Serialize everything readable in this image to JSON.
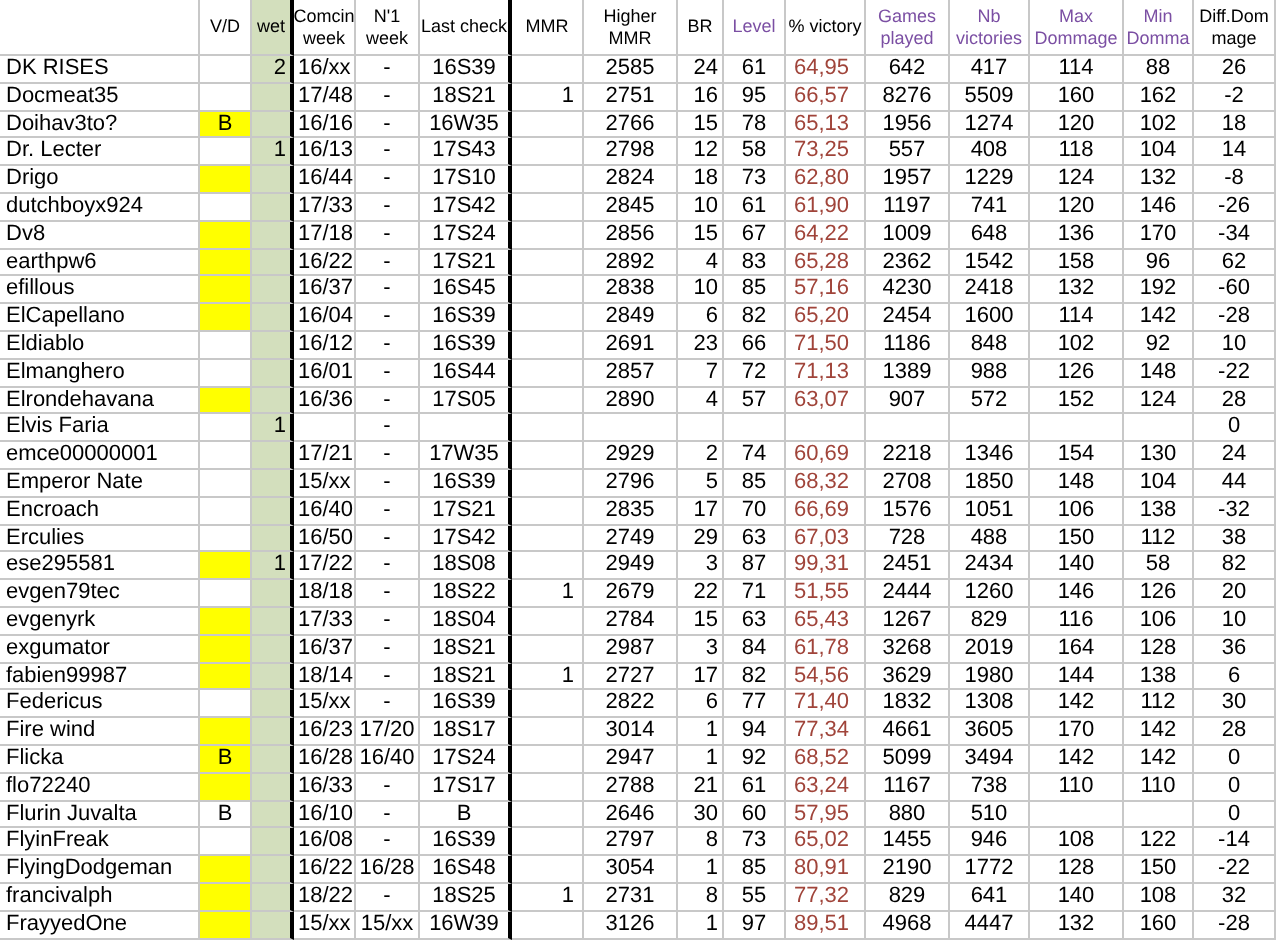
{
  "table": {
    "columns": [
      {},
      {
        "label": "V/D"
      },
      {
        "label": "wet"
      },
      {
        "label": "Comcin\nweek"
      },
      {
        "label": "N'1\nweek"
      },
      {
        "label": "Last check"
      },
      {
        "label": "MMR"
      },
      {
        "label": "Higher\nMMR"
      },
      {
        "label": "BR"
      },
      {
        "label": "Level",
        "color": "#7b4fa3"
      },
      {
        "label": "% victory"
      },
      {
        "label": "Games\nplayed",
        "color": "#7b4fa3"
      },
      {
        "label": "Nb\nvictories",
        "color": "#7b4fa3"
      },
      {
        "label": "Max\nDommage",
        "color": "#7b4fa3"
      },
      {
        "label": "Min\nDomma",
        "color": "#7b4fa3"
      },
      {
        "label": "Diff.Dom\nmage"
      }
    ],
    "rows": [
      {
        "highlighted": false,
        "cells": [
          "DK RISES",
          null,
          "2",
          "16/xx",
          "-",
          "16S39",
          null,
          "2585",
          "24",
          "61",
          "64,95",
          "642",
          "417",
          "114",
          "88",
          "26"
        ]
      },
      {
        "highlighted": false,
        "cells": [
          "Docmeat35",
          null,
          null,
          "17/48",
          "-",
          "18S21",
          "1",
          "2751",
          "16",
          "95",
          "66,57",
          "8276",
          "5509",
          "160",
          "162",
          "-2"
        ]
      },
      {
        "highlighted": true,
        "cells": [
          "Doihav3to?",
          "B",
          null,
          "16/16",
          "-",
          "16W35",
          null,
          "2766",
          "15",
          "78",
          "65,13",
          "1956",
          "1274",
          "120",
          "102",
          "18"
        ]
      },
      {
        "highlighted": false,
        "cells": [
          "Dr. Lecter",
          null,
          "1",
          "16/13",
          "-",
          "17S43",
          null,
          "2798",
          "12",
          "58",
          "73,25",
          "557",
          "408",
          "118",
          "104",
          "14"
        ]
      },
      {
        "highlighted": true,
        "cells": [
          "Drigo",
          null,
          null,
          "16/44",
          "-",
          "17S10",
          null,
          "2824",
          "18",
          "73",
          "62,80",
          "1957",
          "1229",
          "124",
          "132",
          "-8"
        ]
      },
      {
        "highlighted": false,
        "cells": [
          "dutchboyx924",
          null,
          null,
          "17/33",
          "-",
          "17S42",
          null,
          "2845",
          "10",
          "61",
          "61,90",
          "1197",
          "741",
          "120",
          "146",
          "-26"
        ]
      },
      {
        "highlighted": true,
        "cells": [
          "Dv8",
          null,
          null,
          "17/18",
          "-",
          "17S24",
          null,
          "2856",
          "15",
          "67",
          "64,22",
          "1009",
          "648",
          "136",
          "170",
          "-34"
        ]
      },
      {
        "highlighted": true,
        "cells": [
          "earthpw6",
          null,
          null,
          "16/22",
          "-",
          "17S21",
          null,
          "2892",
          "4",
          "83",
          "65,28",
          "2362",
          "1542",
          "158",
          "96",
          "62"
        ]
      },
      {
        "highlighted": true,
        "cells": [
          "efillous",
          null,
          null,
          "16/37",
          "-",
          "16S45",
          null,
          "2838",
          "10",
          "85",
          "57,16",
          "4230",
          "2418",
          "132",
          "192",
          "-60"
        ]
      },
      {
        "highlighted": true,
        "cells": [
          "ElCapellano",
          null,
          null,
          "16/04",
          "-",
          "16S39",
          null,
          "2849",
          "6",
          "82",
          "65,20",
          "2454",
          "1600",
          "114",
          "142",
          "-28"
        ]
      },
      {
        "highlighted": false,
        "cells": [
          "Eldiablo",
          null,
          null,
          "16/12",
          "-",
          "16S39",
          null,
          "2691",
          "23",
          "66",
          "71,50",
          "1186",
          "848",
          "102",
          "92",
          "10"
        ]
      },
      {
        "highlighted": false,
        "cells": [
          "Elmanghero",
          null,
          null,
          "16/01",
          "-",
          "16S44",
          null,
          "2857",
          "7",
          "72",
          "71,13",
          "1389",
          "988",
          "126",
          "148",
          "-22"
        ]
      },
      {
        "highlighted": true,
        "cells": [
          "Elrondehavana",
          null,
          null,
          "16/36",
          "-",
          "17S05",
          null,
          "2890",
          "4",
          "57",
          "63,07",
          "907",
          "572",
          "152",
          "124",
          "28"
        ]
      },
      {
        "highlighted": false,
        "cells": [
          "Elvis Faria",
          null,
          "1",
          null,
          "-",
          null,
          null,
          null,
          null,
          null,
          null,
          null,
          null,
          null,
          null,
          "0"
        ]
      },
      {
        "highlighted": false,
        "cells": [
          "emce00000001",
          null,
          null,
          "17/21",
          "-",
          "17W35",
          null,
          "2929",
          "2",
          "74",
          "60,69",
          "2218",
          "1346",
          "154",
          "130",
          "24"
        ]
      },
      {
        "highlighted": false,
        "cells": [
          "Emperor Nate",
          null,
          null,
          "15/xx",
          "-",
          "16S39",
          null,
          "2796",
          "5",
          "85",
          "68,32",
          "2708",
          "1850",
          "148",
          "104",
          "44"
        ]
      },
      {
        "highlighted": false,
        "cells": [
          "Encroach",
          null,
          null,
          "16/40",
          "-",
          "17S21",
          null,
          "2835",
          "17",
          "70",
          "66,69",
          "1576",
          "1051",
          "106",
          "138",
          "-32"
        ]
      },
      {
        "highlighted": false,
        "cells": [
          "Erculies",
          null,
          null,
          "16/50",
          "-",
          "17S42",
          null,
          "2749",
          "29",
          "63",
          "67,03",
          "728",
          "488",
          "150",
          "112",
          "38"
        ]
      },
      {
        "highlighted": true,
        "cells": [
          "ese295581",
          null,
          "1",
          "17/22",
          "-",
          "18S08",
          null,
          "2949",
          "3",
          "87",
          "99,31",
          "2451",
          "2434",
          "140",
          "58",
          "82"
        ]
      },
      {
        "highlighted": false,
        "cells": [
          "evgen79tec",
          null,
          null,
          "18/18",
          "-",
          "18S22",
          "1",
          "2679",
          "22",
          "71",
          "51,55",
          "2444",
          "1260",
          "146",
          "126",
          "20"
        ]
      },
      {
        "highlighted": true,
        "cells": [
          "evgenyrk",
          null,
          null,
          "17/33",
          "-",
          "18S04",
          null,
          "2784",
          "15",
          "63",
          "65,43",
          "1267",
          "829",
          "116",
          "106",
          "10"
        ]
      },
      {
        "highlighted": true,
        "cells": [
          "exgumator",
          null,
          null,
          "16/37",
          "-",
          "18S21",
          null,
          "2987",
          "3",
          "84",
          "61,78",
          "3268",
          "2019",
          "164",
          "128",
          "36"
        ]
      },
      {
        "highlighted": true,
        "cells": [
          "fabien99987",
          null,
          null,
          "18/14",
          "-",
          "18S21",
          "1",
          "2727",
          "17",
          "82",
          "54,56",
          "3629",
          "1980",
          "144",
          "138",
          "6"
        ]
      },
      {
        "highlighted": false,
        "cells": [
          "Federicus",
          null,
          null,
          "15/xx",
          "-",
          "16S39",
          null,
          "2822",
          "6",
          "77",
          "71,40",
          "1832",
          "1308",
          "142",
          "112",
          "30"
        ]
      },
      {
        "highlighted": true,
        "cells": [
          "Fire wind",
          null,
          null,
          "16/23",
          "17/20",
          "18S17",
          null,
          "3014",
          "1",
          "94",
          "77,34",
          "4661",
          "3605",
          "170",
          "142",
          "28"
        ]
      },
      {
        "highlighted": true,
        "cells": [
          "Flicka",
          "B",
          null,
          "16/28",
          "16/40",
          "17S24",
          null,
          "2947",
          "1",
          "92",
          "68,52",
          "5099",
          "3494",
          "142",
          "142",
          "0"
        ]
      },
      {
        "highlighted": true,
        "cells": [
          "flo72240",
          null,
          null,
          "16/33",
          "-",
          "17S17",
          null,
          "2788",
          "21",
          "61",
          "63,24",
          "1167",
          "738",
          "110",
          "110",
          "0"
        ]
      },
      {
        "highlighted": false,
        "cells": [
          "Flurin Juvalta",
          "B",
          null,
          "16/10",
          "-",
          "B",
          null,
          "2646",
          "30",
          "60",
          "57,95",
          "880",
          "510",
          null,
          null,
          "0"
        ]
      },
      {
        "highlighted": false,
        "cells": [
          "FlyinFreak",
          null,
          null,
          "16/08",
          "-",
          "16S39",
          null,
          "2797",
          "8",
          "73",
          "65,02",
          "1455",
          "946",
          "108",
          "122",
          "-14"
        ]
      },
      {
        "highlighted": true,
        "cells": [
          "FlyingDodgeman",
          null,
          null,
          "16/22",
          "16/28",
          "16S48",
          null,
          "3054",
          "1",
          "85",
          "80,91",
          "2190",
          "1772",
          "128",
          "150",
          "-22"
        ]
      },
      {
        "highlighted": true,
        "cells": [
          "francivalph",
          null,
          null,
          "18/22",
          "-",
          "18S25",
          "1",
          "2731",
          "8",
          "55",
          "77,32",
          "829",
          "641",
          "140",
          "108",
          "32"
        ]
      },
      {
        "highlighted": true,
        "cells": [
          "FrayyedOne",
          null,
          null,
          "15/xx",
          "15/xx",
          "16W39",
          null,
          "3126",
          "1",
          "97",
          "89,51",
          "4968",
          "4447",
          "132",
          "160",
          "-28"
        ]
      }
    ]
  }
}
